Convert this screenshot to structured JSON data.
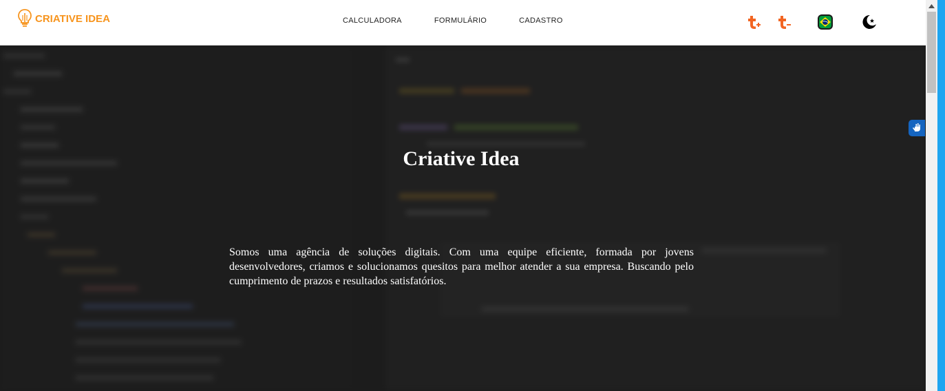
{
  "header": {
    "logo_text": "CRIATIVE IDEA",
    "nav": [
      {
        "label": "CALCULADORA"
      },
      {
        "label": "FORMULÁRIO"
      },
      {
        "label": "CADASTRO"
      }
    ],
    "icons": {
      "logo": "lightbulb-icon",
      "font_increase": "font-size-increase-icon",
      "font_decrease": "font-size-decrease-icon",
      "language": "brazil-flag-icon",
      "theme": "dark-mode-moon-icon"
    }
  },
  "hero": {
    "title": "Criative Idea",
    "text": "Somos uma agência de soluções digitais. Com uma equipe eficiente, formada por jovens desenvolvedores, criamos e solucionamos quesitos para melhor atender a sua empresa. Buscando pelo cumprimento de prazos e resultados satisfatórios."
  },
  "accessibility": {
    "icon": "hand-sign-language-icon"
  },
  "colors": {
    "brand": "#f7941d",
    "accent_icons": "#f26522",
    "hero_bg": "#222222",
    "side_strip": "#1ea5f0"
  }
}
